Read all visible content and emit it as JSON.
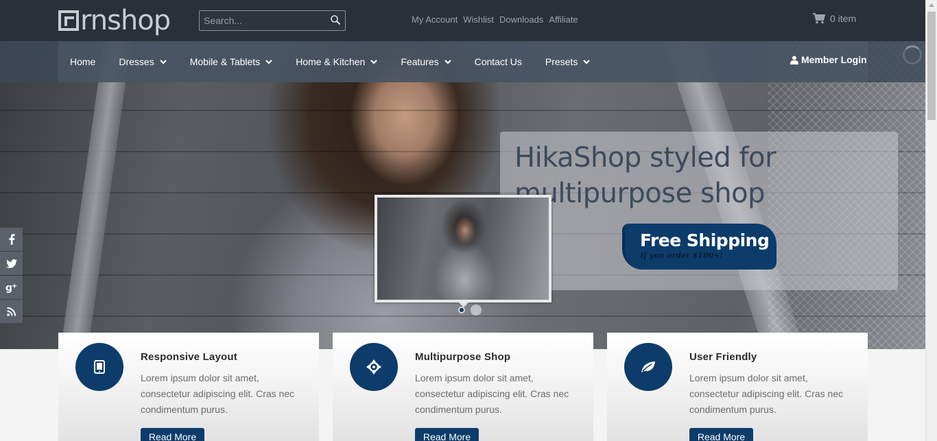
{
  "header": {
    "logo_text": "rnshop",
    "search": {
      "placeholder": "Search..."
    },
    "links": [
      "My Account",
      "Wishlist",
      "Downloads",
      "Affiliate"
    ],
    "cart": {
      "label": "0 item"
    }
  },
  "nav": {
    "items": [
      {
        "label": "Home",
        "dropdown": false
      },
      {
        "label": "Dresses",
        "dropdown": true
      },
      {
        "label": "Mobile & Tablets",
        "dropdown": true
      },
      {
        "label": "Home & Kitchen",
        "dropdown": true
      },
      {
        "label": "Features",
        "dropdown": true
      },
      {
        "label": "Contact Us",
        "dropdown": false
      },
      {
        "label": "Presets",
        "dropdown": true
      }
    ],
    "member_login": "Member Login"
  },
  "hero": {
    "title": "HikaShop styled for multipurpose shop",
    "badge_title": "Free Shipping",
    "badge_sub": "If you order $100+!",
    "slide_count": 2,
    "active_slide": 0
  },
  "social": [
    "facebook-icon",
    "twitter-icon",
    "google-plus-icon",
    "rss-icon"
  ],
  "features": [
    {
      "icon": "tablet-icon",
      "title": "Responsive Layout",
      "text": "Lorem ipsum dolor sit amet, consectetur adipiscing elit. Cras nec condimentum purus.",
      "button": "Read More"
    },
    {
      "icon": "crosshair-icon",
      "title": "Multipurpose Shop",
      "text": "Lorem ipsum dolor sit amet, consectetur adipiscing elit. Cras nec condimentum purus.",
      "button": "Read More"
    },
    {
      "icon": "leaf-icon",
      "title": "User Friendly",
      "text": "Lorem ipsum dolor sit amet, consectetur adipiscing elit. Cras nec condimentum purus.",
      "button": "Read More"
    }
  ],
  "colors": {
    "primary": "#0d3c6b",
    "topbar": "#283039"
  }
}
